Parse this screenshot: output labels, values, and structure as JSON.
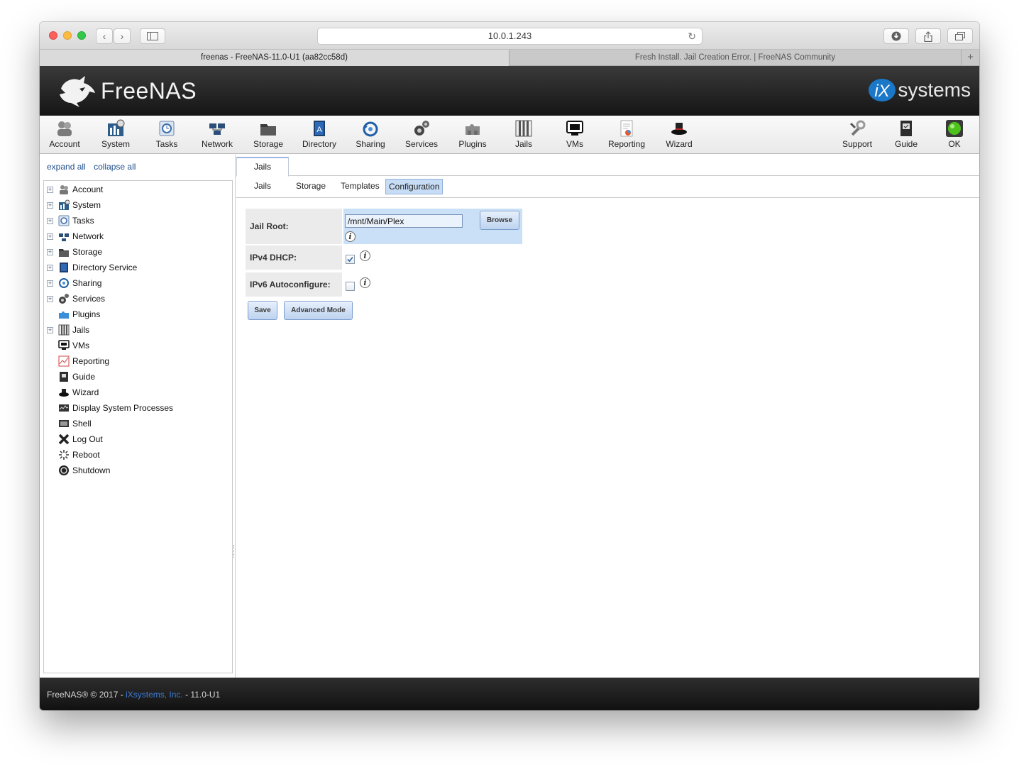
{
  "browser": {
    "address": "10.0.1.243",
    "tabs": [
      {
        "label": "freenas - FreeNAS-11.0-U1 (aa82cc58d)",
        "active": true
      },
      {
        "label": "Fresh Install. Jail Creation Error. | FreeNAS Community",
        "active": false
      }
    ],
    "new_tab": "+"
  },
  "header": {
    "brand": "FreeNAS",
    "vendor": "systems",
    "vendor_mark": "iX"
  },
  "topmenu": [
    {
      "label": "Account",
      "icon": "account-icon"
    },
    {
      "label": "System",
      "icon": "system-icon"
    },
    {
      "label": "Tasks",
      "icon": "tasks-icon"
    },
    {
      "label": "Network",
      "icon": "network-icon"
    },
    {
      "label": "Storage",
      "icon": "storage-icon"
    },
    {
      "label": "Directory",
      "icon": "directory-icon"
    },
    {
      "label": "Sharing",
      "icon": "sharing-icon"
    },
    {
      "label": "Services",
      "icon": "services-icon"
    },
    {
      "label": "Plugins",
      "icon": "plugins-icon"
    },
    {
      "label": "Jails",
      "icon": "jails-icon"
    },
    {
      "label": "VMs",
      "icon": "vms-icon"
    },
    {
      "label": "Reporting",
      "icon": "reporting-icon"
    },
    {
      "label": "Wizard",
      "icon": "wizard-icon"
    },
    {
      "label": "Support",
      "icon": "support-icon"
    },
    {
      "label": "Guide",
      "icon": "guide-icon"
    },
    {
      "label": "OK",
      "icon": "status-ok-icon"
    }
  ],
  "tree": {
    "expand_all": "expand all",
    "collapse_all": "collapse all",
    "items": [
      {
        "label": "Account",
        "expandable": true
      },
      {
        "label": "System",
        "expandable": true
      },
      {
        "label": "Tasks",
        "expandable": true
      },
      {
        "label": "Network",
        "expandable": true
      },
      {
        "label": "Storage",
        "expandable": true
      },
      {
        "label": "Directory Service",
        "expandable": true
      },
      {
        "label": "Sharing",
        "expandable": true
      },
      {
        "label": "Services",
        "expandable": true
      },
      {
        "label": "Plugins",
        "expandable": false
      },
      {
        "label": "Jails",
        "expandable": true
      },
      {
        "label": "VMs",
        "expandable": false
      },
      {
        "label": "Reporting",
        "expandable": false
      },
      {
        "label": "Guide",
        "expandable": false
      },
      {
        "label": "Wizard",
        "expandable": false
      },
      {
        "label": "Display System Processes",
        "expandable": false
      },
      {
        "label": "Shell",
        "expandable": false
      },
      {
        "label": "Log Out",
        "expandable": false
      },
      {
        "label": "Reboot",
        "expandable": false
      },
      {
        "label": "Shutdown",
        "expandable": false
      }
    ]
  },
  "main": {
    "top_tab": "Jails",
    "sub_tabs": [
      "Jails",
      "Storage",
      "Templates",
      "Configuration"
    ],
    "selected_sub_tab": "Configuration",
    "form": {
      "jail_root_label": "Jail Root:",
      "jail_root_value": "/mnt/Main/Plex",
      "browse_label": "Browse",
      "ipv4_label": "IPv4 DHCP:",
      "ipv4_checked": true,
      "ipv6_label": "IPv6 Autoconfigure:",
      "ipv6_checked": false,
      "save_label": "Save",
      "advanced_label": "Advanced Mode"
    }
  },
  "footer": {
    "prefix": "FreeNAS® © 2017 - ",
    "link": "iXsystems, Inc.",
    "suffix": " - 11.0-U1"
  },
  "colors": {
    "header_bg": "#1c1c1c",
    "accent_blue": "#3d7bd1",
    "selected_tab": "#c7ddf5",
    "status_ok": "#4ec21c"
  }
}
